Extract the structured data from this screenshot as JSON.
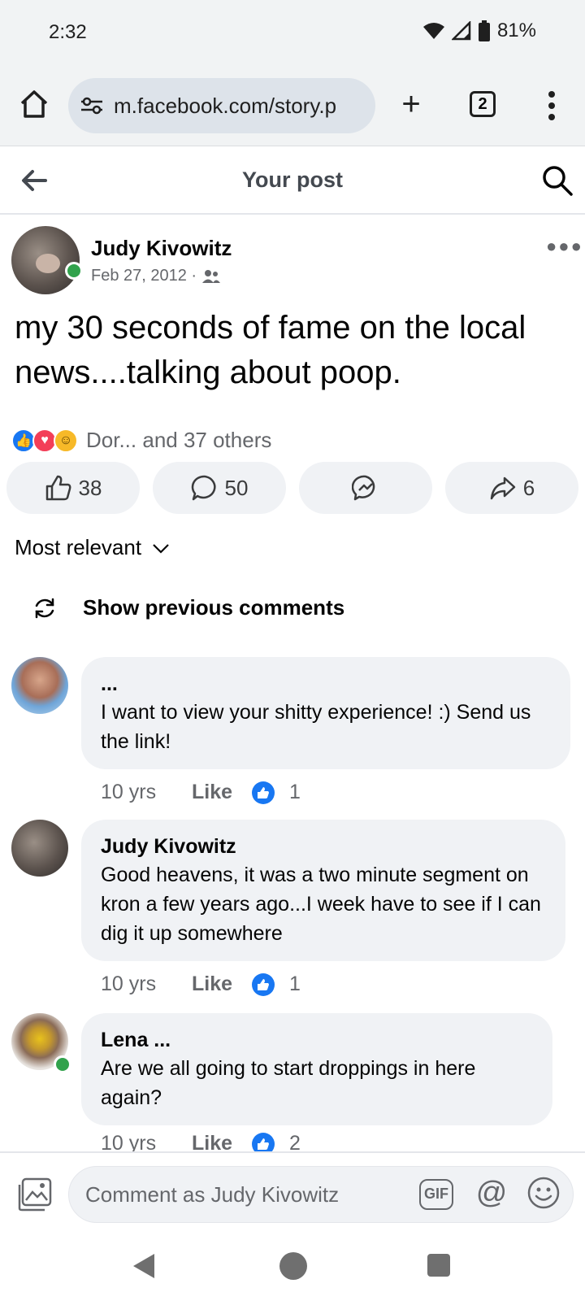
{
  "status_bar": {
    "time": "2:32",
    "battery": "81%"
  },
  "browser": {
    "url": "m.facebook.com/story.p",
    "tab_count": "2"
  },
  "header": {
    "title": "Your post"
  },
  "post": {
    "author": "Judy Kivowitz",
    "date": "Feb 27, 2012 ·",
    "text": "my 30 seconds of fame on the local news....talking about poop.",
    "reaction_summary": "Dor... and 37 others",
    "like_count": "38",
    "comment_count": "50",
    "share_count": "6"
  },
  "sort_label": "Most relevant",
  "show_previous_label": "Show previous comments",
  "comments": [
    {
      "author": "...",
      "text": "I want to view your shitty experience! :)  Send us the link!",
      "time": "10 yrs",
      "like_label": "Like",
      "reactions": "1"
    },
    {
      "author": "Judy Kivowitz",
      "text": "Good heavens, it was a two minute segment on kron a few years ago...I week have to see if I can dig it up somewhere",
      "time": "10 yrs",
      "like_label": "Like",
      "reactions": "1"
    },
    {
      "author": "Lena ...",
      "text": "Are we all going to start droppings in here again?",
      "time": "10 yrs",
      "like_label": "Like",
      "reactions": "2"
    }
  ],
  "composer": {
    "placeholder": "Comment as Judy Kivowitz",
    "gif_label": "GIF",
    "mention_label": "@"
  },
  "colors": {
    "accent": "#1877f2",
    "bubble": "#f0f2f5",
    "online": "#31a24c"
  },
  "icons": {
    "home": "home-icon",
    "site_settings": "tune-icon",
    "new_tab": "plus-icon",
    "tabs": "tabs-icon",
    "menu": "kebab-icon",
    "back": "arrow-left-icon",
    "search": "search-icon",
    "like": "thumbs-up-icon",
    "comment": "comment-icon",
    "messenger": "messenger-icon",
    "share": "share-icon"
  }
}
